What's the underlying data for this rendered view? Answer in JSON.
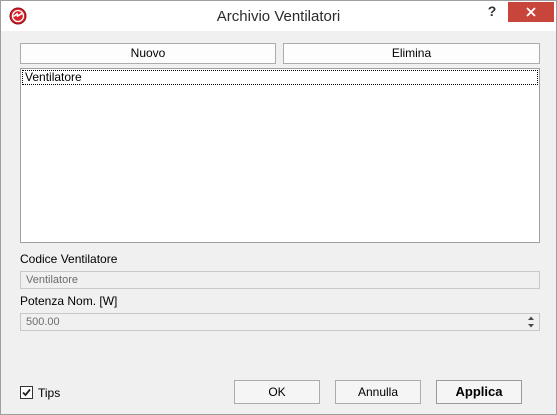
{
  "window": {
    "title": "Archivio Ventilatori",
    "help_label": "?",
    "accent_close_color": "#c7453a",
    "app_icon": "app-logo-icon"
  },
  "toolbar": {
    "new_label": "Nuovo",
    "delete_label": "Elimina"
  },
  "list": {
    "items": [
      {
        "label": "Ventilatore",
        "selected": true
      }
    ]
  },
  "form": {
    "code_label": "Codice Ventilatore",
    "code_value": "Ventilatore",
    "power_label": "Potenza Nom. [W]",
    "power_value": "500.00"
  },
  "footer": {
    "tips_label": "Tips",
    "tips_checked": true,
    "ok_label": "OK",
    "cancel_label": "Annulla",
    "apply_label": "Applica"
  }
}
